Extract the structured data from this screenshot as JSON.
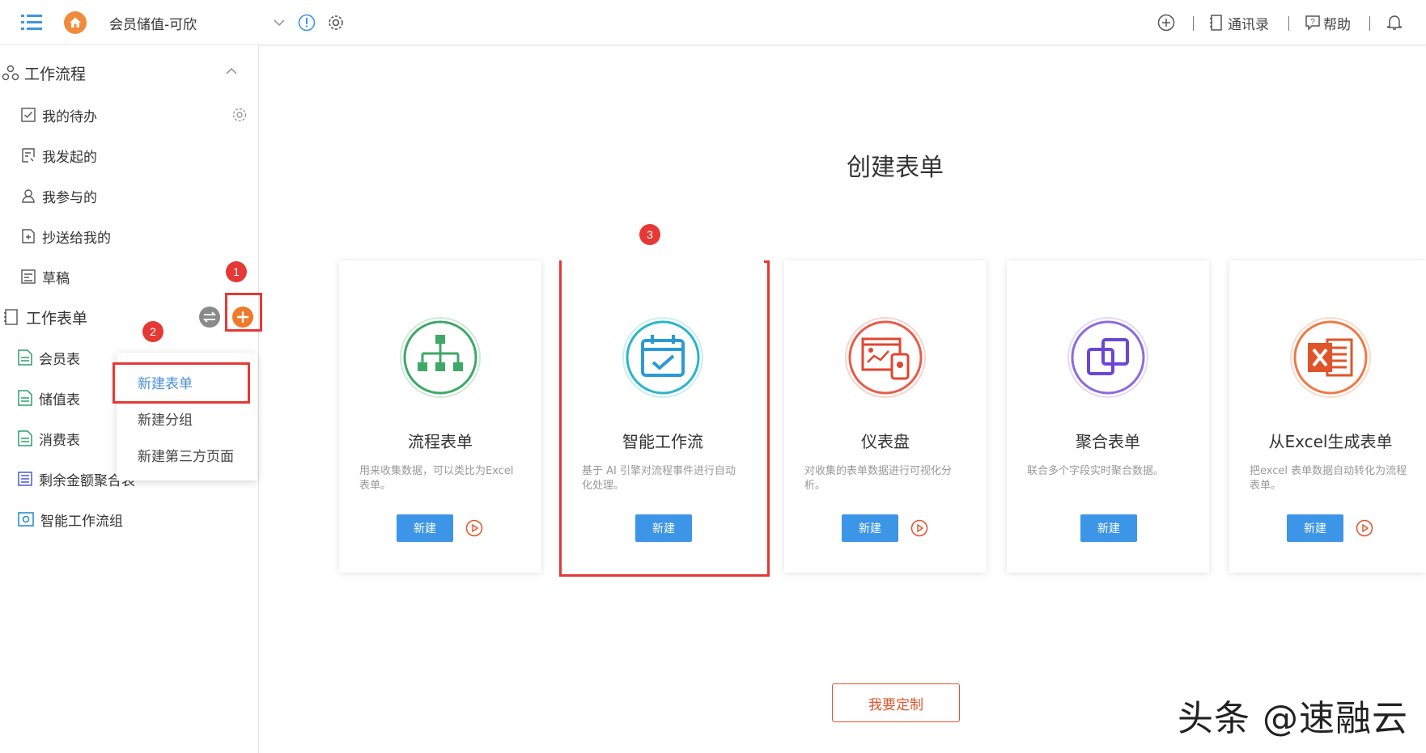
{
  "topbar": {
    "app_title": "会员储值-可欣",
    "contacts_label": "通讯录",
    "help_label": "帮助"
  },
  "sidebar": {
    "workflow_section": "工作流程",
    "workflow_items": [
      "我的待办",
      "我发起的",
      "我参与的",
      "抄送给我的",
      "草稿"
    ],
    "forms_section": "工作表单",
    "form_items": [
      "会员表",
      "储值表",
      "消费表",
      "剩余金额聚合表",
      "智能工作流组"
    ]
  },
  "dropdown": {
    "items": [
      "新建表单",
      "新建分组",
      "新建第三方页面"
    ]
  },
  "annotations": [
    "1",
    "2",
    "3"
  ],
  "main": {
    "title": "创建表单",
    "cards": [
      {
        "title": "流程表单",
        "desc": "用来收集数据，可以类比为Excel 表单。",
        "button": "新建",
        "icon": "org-chart-icon"
      },
      {
        "title": "智能工作流",
        "desc": "基于 AI 引擎对流程事件进行自动化处理。",
        "button": "新建",
        "icon": "calendar-check-icon"
      },
      {
        "title": "仪表盘",
        "desc": "对收集的表单数据进行可视化分析。",
        "button": "新建",
        "icon": "dashboard-icon"
      },
      {
        "title": "聚合表单",
        "desc": "联合多个字段实时聚合数据。",
        "button": "新建",
        "icon": "link-squares-icon"
      },
      {
        "title": "从Excel生成表单",
        "desc": "把excel 表单数据自动转化为流程表单。",
        "button": "新建",
        "icon": "excel-icon"
      }
    ],
    "custom_button": "我要定制"
  },
  "watermark": "头条 @速融云",
  "colors": {
    "primary_button": "#3d95e8",
    "accent_orange": "#e0542a",
    "annotation_red": "#e53935"
  }
}
